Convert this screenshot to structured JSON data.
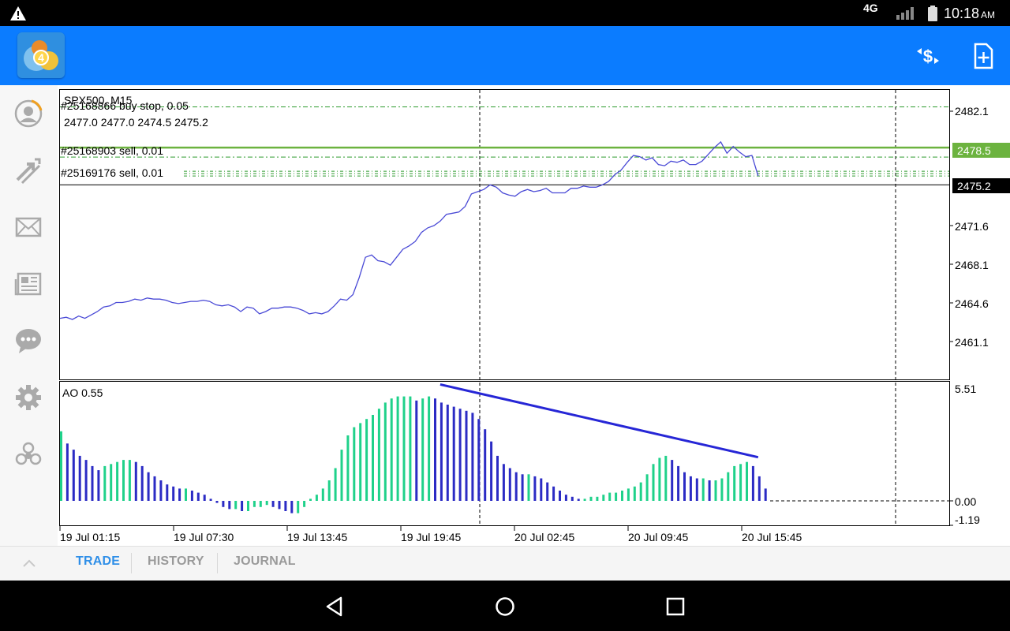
{
  "status_bar": {
    "network": "4G",
    "time": "10:18",
    "ampm": "AM",
    "icons": [
      "warning-icon",
      "signal-icon",
      "battery-icon"
    ]
  },
  "app_bar": {
    "logo": "metatrader-4-logo",
    "actions": [
      "one-click-trading-icon",
      "new-order-icon"
    ]
  },
  "sidebar": {
    "items": [
      "account-icon",
      "trade-arrows-icon",
      "mail-icon",
      "news-icon",
      "chat-icon",
      "settings-icon",
      "community-icon"
    ]
  },
  "chart": {
    "symbol_title": "SPX500, M15",
    "order_label": "#25168866 buy stop, 0.05",
    "ohlc": "2477.0 2477.0 2474.5 2475.2",
    "sell_label_1": "#25168903 sell, 0.01",
    "sell_label_2": "#25169176 sell, 0.01",
    "price_ticks": [
      "2482.1",
      "2471.6",
      "2468.1",
      "2464.6",
      "2461.1"
    ],
    "highlight_price": "2478.5",
    "current_price": "2475.2",
    "indicator_label": "AO 0.55",
    "ao_ticks": [
      "5.51",
      "0.00",
      "-1.19"
    ],
    "time_ticks": [
      "19 Jul 01:15",
      "19 Jul 07:30",
      "19 Jul 13:45",
      "19 Jul 19:45",
      "20 Jul 02:45",
      "20 Jul 09:45",
      "20 Jul 15:45"
    ],
    "colors": {
      "price_line": "#4a4ad6",
      "order_line": "#6cb33f",
      "level_line": "#2c9a2c",
      "ao_up": "#1fd18a",
      "ao_down": "#2b2bc4",
      "trend_line": "#2626d6"
    }
  },
  "chart_data": {
    "type": "line",
    "title": "SPX500, M15",
    "ylim": [
      2458.0,
      2483.6
    ],
    "y_ticks": [
      2482.1,
      2471.6,
      2468.1,
      2464.6,
      2461.1
    ],
    "series": [
      {
        "name": "SPX500",
        "y": [
          2463.4,
          2463.5,
          2463.3,
          2463.6,
          2463.4,
          2463.7,
          2464.0,
          2464.4,
          2464.5,
          2464.8,
          2464.8,
          2464.9,
          2465.1,
          2465.0,
          2465.2,
          2465.1,
          2465.1,
          2465.0,
          2464.8,
          2464.7,
          2464.8,
          2464.9,
          2464.9,
          2465.0,
          2464.9,
          2464.6,
          2464.5,
          2464.6,
          2464.4,
          2464.0,
          2464.4,
          2464.3,
          2463.8,
          2464.0,
          2464.3,
          2464.3,
          2464.4,
          2464.4,
          2464.3,
          2464.1,
          2463.8,
          2463.9,
          2463.8,
          2464.0,
          2464.5,
          2465.1,
          2465.0,
          2465.5,
          2467.0,
          2468.8,
          2469.0,
          2468.5,
          2468.4,
          2468.1,
          2468.8,
          2469.5,
          2469.8,
          2470.2,
          2471.0,
          2471.4,
          2471.6,
          2472.0,
          2472.6,
          2472.7,
          2472.8,
          2473.3,
          2474.4,
          2474.6,
          2474.8,
          2475.2,
          2475.0,
          2474.5,
          2474.3,
          2474.2,
          2474.6,
          2474.8,
          2474.6,
          2474.7,
          2474.9,
          2474.5,
          2474.5,
          2474.5,
          2474.9,
          2474.9,
          2475.1,
          2475.0,
          2475.0,
          2475.2,
          2475.5,
          2476.1,
          2476.5,
          2477.2,
          2477.8,
          2477.7,
          2477.4,
          2477.6,
          2477.0,
          2476.9,
          2477.3,
          2477.2,
          2477.4,
          2477.0,
          2477.0,
          2477.3,
          2477.9,
          2478.5,
          2479.0,
          2478.0,
          2478.6,
          2478.1,
          2477.7,
          2477.8,
          2476.0
        ]
      }
    ],
    "levels": [
      {
        "label": "#25168866 buy stop, 0.05",
        "value": 2482.1
      },
      {
        "label": "#25168903 sell, 0.01",
        "value": 2478.5
      },
      {
        "label": "#25169176 sell, 0.01",
        "value": 2476.2
      }
    ],
    "current_value": 2475.2,
    "indicator": {
      "name": "AO",
      "value": 0.55,
      "ylim": [
        -1.19,
        5.51
      ],
      "values": [
        3.4,
        2.8,
        2.5,
        2.2,
        2.0,
        1.7,
        1.5,
        1.7,
        1.8,
        1.9,
        2.0,
        2.0,
        1.9,
        1.7,
        1.4,
        1.2,
        1.0,
        0.8,
        0.7,
        0.6,
        0.6,
        0.5,
        0.4,
        0.3,
        0.1,
        -0.1,
        -0.3,
        -0.4,
        -0.4,
        -0.5,
        -0.5,
        -0.3,
        -0.3,
        -0.2,
        -0.3,
        -0.4,
        -0.5,
        -0.6,
        -0.6,
        -0.3,
        0.1,
        0.3,
        0.6,
        1.0,
        1.6,
        2.5,
        3.2,
        3.6,
        3.8,
        4.0,
        4.2,
        4.5,
        4.8,
        5.0,
        5.1,
        5.1,
        5.1,
        4.9,
        5.0,
        5.1,
        5.0,
        4.8,
        4.7,
        4.6,
        4.5,
        4.4,
        4.3,
        4.0,
        3.5,
        2.9,
        2.2,
        1.8,
        1.6,
        1.4,
        1.3,
        1.3,
        1.2,
        1.1,
        0.9,
        0.7,
        0.5,
        0.3,
        0.2,
        0.1,
        0.1,
        0.2,
        0.2,
        0.3,
        0.4,
        0.4,
        0.5,
        0.6,
        0.7,
        0.9,
        1.3,
        1.8,
        2.1,
        2.2,
        2.0,
        1.7,
        1.4,
        1.2,
        1.1,
        1.1,
        1.0,
        1.0,
        1.1,
        1.4,
        1.7,
        1.8,
        1.9,
        1.7,
        1.2,
        0.6
      ],
      "trend_line": {
        "from_index": 61,
        "to_index": 112
      }
    },
    "x_ticks": [
      "19 Jul 01:15",
      "19 Jul 07:30",
      "19 Jul 13:45",
      "19 Jul 19:45",
      "20 Jul 02:45",
      "20 Jul 09:45",
      "20 Jul 15:45"
    ]
  },
  "tabs": {
    "collapse_icon": "chevron-up-icon",
    "trade": "TRADE",
    "history": "HISTORY",
    "journal": "JOURNAL"
  },
  "nav": [
    "back-icon",
    "home-icon",
    "recents-icon"
  ]
}
